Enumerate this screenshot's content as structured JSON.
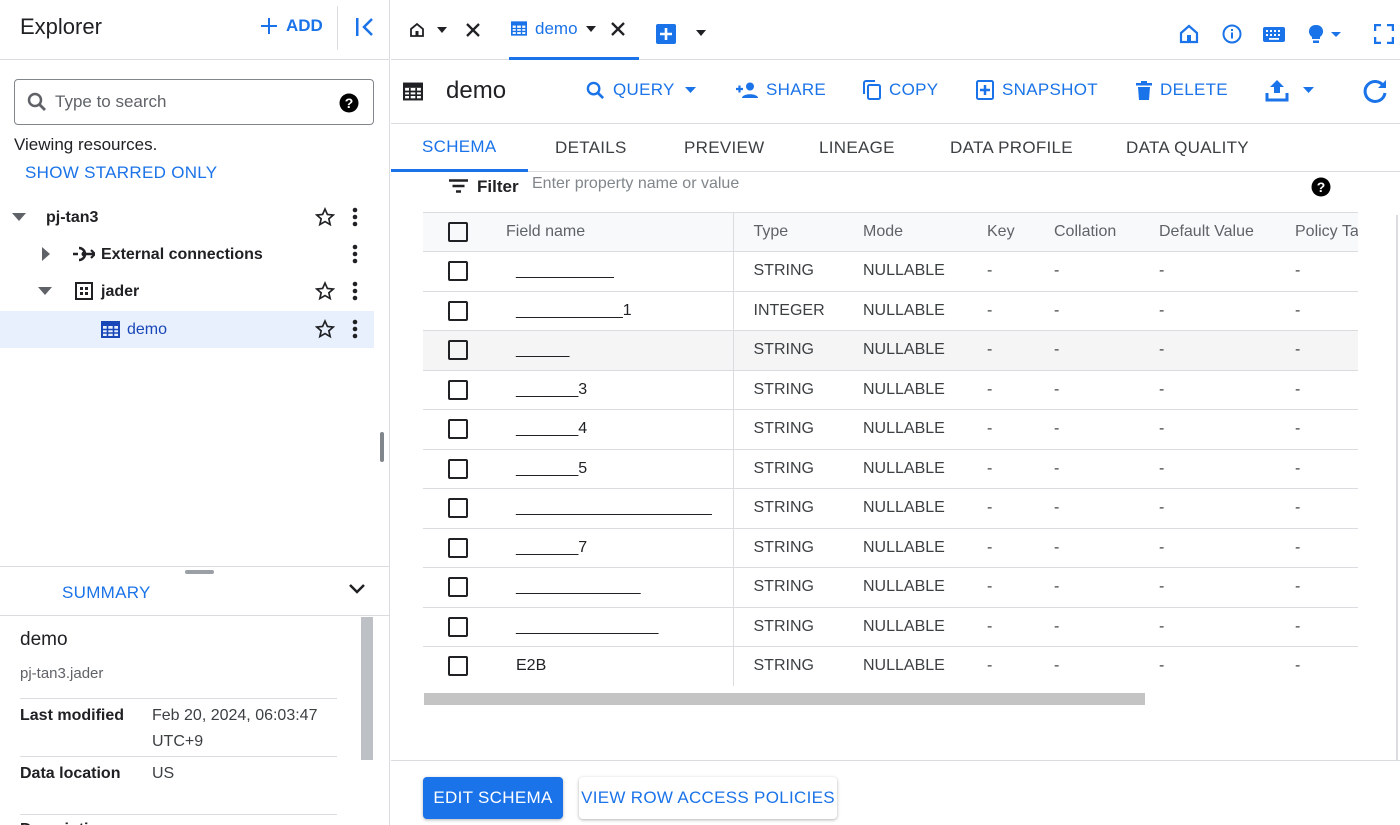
{
  "explorer": {
    "title": "Explorer",
    "add_label": "ADD",
    "search_placeholder": "Type to search",
    "viewing_text": "Viewing resources.",
    "show_starred": "SHOW STARRED ONLY",
    "tree": [
      {
        "label": "pj-tan3",
        "type": "project"
      },
      {
        "label": "External connections",
        "type": "connections"
      },
      {
        "label": "jader",
        "type": "dataset"
      },
      {
        "label": "demo",
        "type": "table",
        "selected": true
      }
    ]
  },
  "summary": {
    "tab_label": "SUMMARY",
    "name": "demo",
    "path": "pj-tan3.jader",
    "last_modified_key": "Last modified",
    "last_modified_val": "Feb 20, 2024, 06:03:47 UTC+9",
    "location_key": "Data location",
    "location_val": "US",
    "next_key": "Description"
  },
  "tabs": {
    "demo_label": "demo"
  },
  "toolbar": {
    "title": "demo",
    "query": "QUERY",
    "share": "SHARE",
    "copy": "COPY",
    "snapshot": "SNAPSHOT",
    "delete": "DELETE"
  },
  "subtabs": [
    "SCHEMA",
    "DETAILS",
    "PREVIEW",
    "LINEAGE",
    "DATA PROFILE",
    "DATA QUALITY"
  ],
  "filter": {
    "label": "Filter",
    "placeholder": "Enter property name or value"
  },
  "schema": {
    "columns": [
      "Field name",
      "Type",
      "Mode",
      "Key",
      "Collation",
      "Default Value",
      "Policy Tags"
    ],
    "rows": [
      {
        "name": "___________",
        "type": "STRING",
        "mode": "NULLABLE",
        "key": "-",
        "collation": "-",
        "default": "-",
        "policy": "-"
      },
      {
        "name": "____________1",
        "type": "INTEGER",
        "mode": "NULLABLE",
        "key": "-",
        "collation": "-",
        "default": "-",
        "policy": "-"
      },
      {
        "name": "______",
        "type": "STRING",
        "mode": "NULLABLE",
        "key": "-",
        "collation": "-",
        "default": "-",
        "policy": "-"
      },
      {
        "name": "_______3",
        "type": "STRING",
        "mode": "NULLABLE",
        "key": "-",
        "collation": "-",
        "default": "-",
        "policy": "-"
      },
      {
        "name": "_______4",
        "type": "STRING",
        "mode": "NULLABLE",
        "key": "-",
        "collation": "-",
        "default": "-",
        "policy": "-"
      },
      {
        "name": "_______5",
        "type": "STRING",
        "mode": "NULLABLE",
        "key": "-",
        "collation": "-",
        "default": "-",
        "policy": "-"
      },
      {
        "name": "______________________",
        "type": "STRING",
        "mode": "NULLABLE",
        "key": "-",
        "collation": "-",
        "default": "-",
        "policy": "-"
      },
      {
        "name": "_______7",
        "type": "STRING",
        "mode": "NULLABLE",
        "key": "-",
        "collation": "-",
        "default": "-",
        "policy": "-"
      },
      {
        "name": "______________",
        "type": "STRING",
        "mode": "NULLABLE",
        "key": "-",
        "collation": "-",
        "default": "-",
        "policy": "-"
      },
      {
        "name": "________________",
        "type": "STRING",
        "mode": "NULLABLE",
        "key": "-",
        "collation": "-",
        "default": "-",
        "policy": "-"
      },
      {
        "name": "E2B",
        "type": "STRING",
        "mode": "NULLABLE",
        "key": "-",
        "collation": "-",
        "default": "-",
        "policy": "-"
      }
    ]
  },
  "bottom": {
    "edit_schema": "EDIT SCHEMA",
    "row_access": "VIEW ROW ACCESS POLICIES"
  },
  "colors": {
    "accent": "#1a73e8",
    "selected_bg": "#e8f0fe",
    "table_icon": "#1a47b8"
  },
  "icons": [
    "plus-icon",
    "collapse-panel-icon",
    "search-icon",
    "help-icon",
    "star-icon",
    "more-vert-icon",
    "caret-icon",
    "connection-icon",
    "dataset-icon",
    "table-icon",
    "home-icon",
    "close-icon",
    "add-tab-icon",
    "info-icon",
    "keyboard-icon",
    "lightbulb-icon",
    "fullscreen-icon",
    "query-search-icon",
    "share-person-icon",
    "copy-icon",
    "snapshot-icon",
    "delete-icon",
    "export-icon",
    "refresh-icon",
    "filter-icon",
    "chevron-down-icon"
  ]
}
